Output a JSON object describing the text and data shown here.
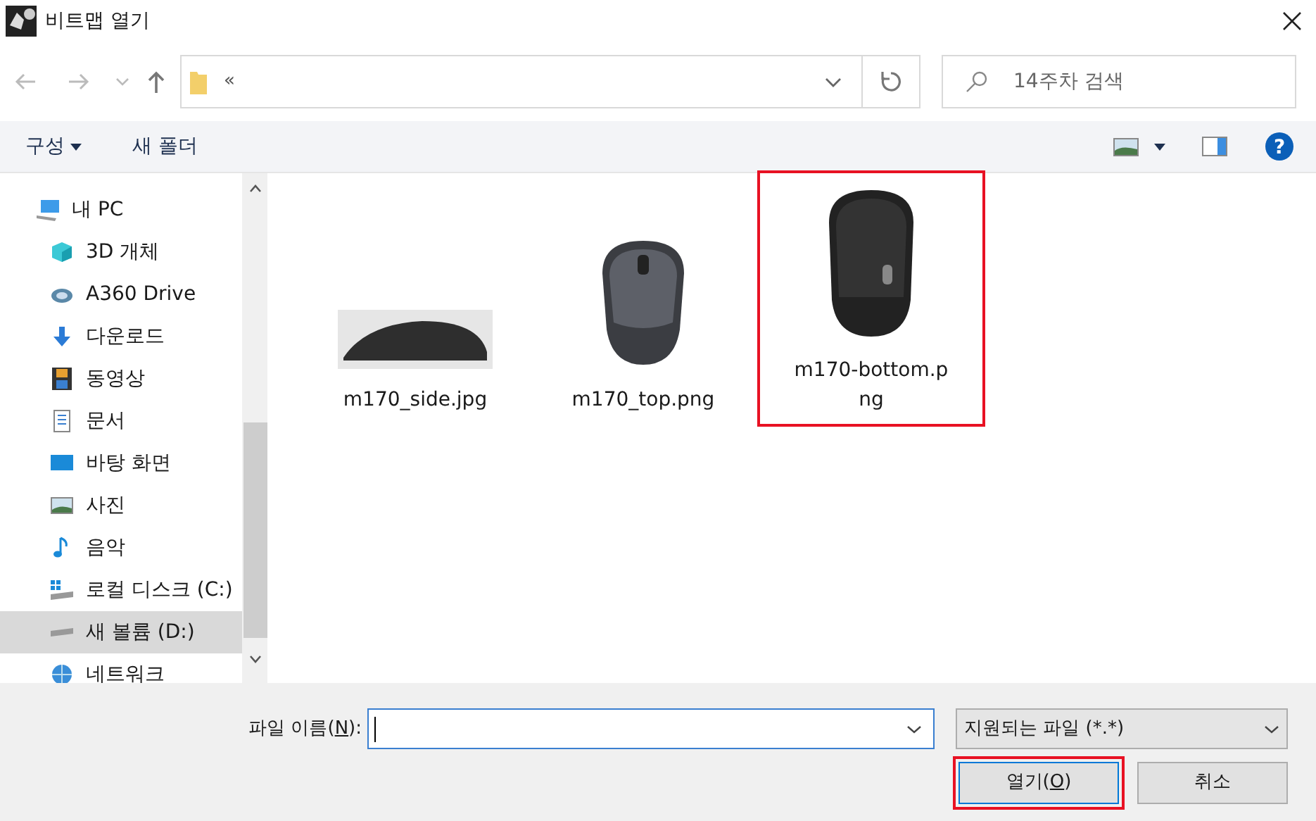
{
  "window": {
    "title": "비트맵 열기"
  },
  "address": {
    "text": "«"
  },
  "search": {
    "placeholder": "14주차 검색"
  },
  "toolbar": {
    "organize": "구성",
    "new_folder": "새 폴더"
  },
  "sidebar": {
    "items": [
      {
        "label": "내 PC",
        "kind": "pc",
        "selected": false
      },
      {
        "label": "3D 개체",
        "kind": "cube",
        "selected": false
      },
      {
        "label": "A360 Drive",
        "kind": "cloud",
        "selected": false
      },
      {
        "label": "다운로드",
        "kind": "download",
        "selected": false
      },
      {
        "label": "동영상",
        "kind": "film",
        "selected": false
      },
      {
        "label": "문서",
        "kind": "doc",
        "selected": false
      },
      {
        "label": "바탕 화면",
        "kind": "desktop",
        "selected": false
      },
      {
        "label": "사진",
        "kind": "picture",
        "selected": false
      },
      {
        "label": "음악",
        "kind": "music",
        "selected": false
      },
      {
        "label": "로컬 디스크 (C:)",
        "kind": "sysdrive",
        "selected": false
      },
      {
        "label": "새 볼륨 (D:)",
        "kind": "drive",
        "selected": true
      },
      {
        "label": "네트워크",
        "kind": "network",
        "selected": false
      }
    ]
  },
  "files": [
    {
      "name": "m170_side.jpg",
      "kind": "side",
      "highlighted": false
    },
    {
      "name": "m170_top.png",
      "kind": "top",
      "highlighted": false
    },
    {
      "name": "m170-bottom.png",
      "kind": "bottom",
      "highlighted": true
    }
  ],
  "help": {
    "glyph": "?"
  },
  "footer": {
    "filename_label": {
      "before": "파일 이름(",
      "key": "N",
      "after": "):"
    },
    "filetype": "지원되는 파일 (*.*)",
    "open_label": {
      "before": "열기(",
      "key": "O",
      "after": ")"
    },
    "open_highlighted": true,
    "cancel": "취소"
  }
}
